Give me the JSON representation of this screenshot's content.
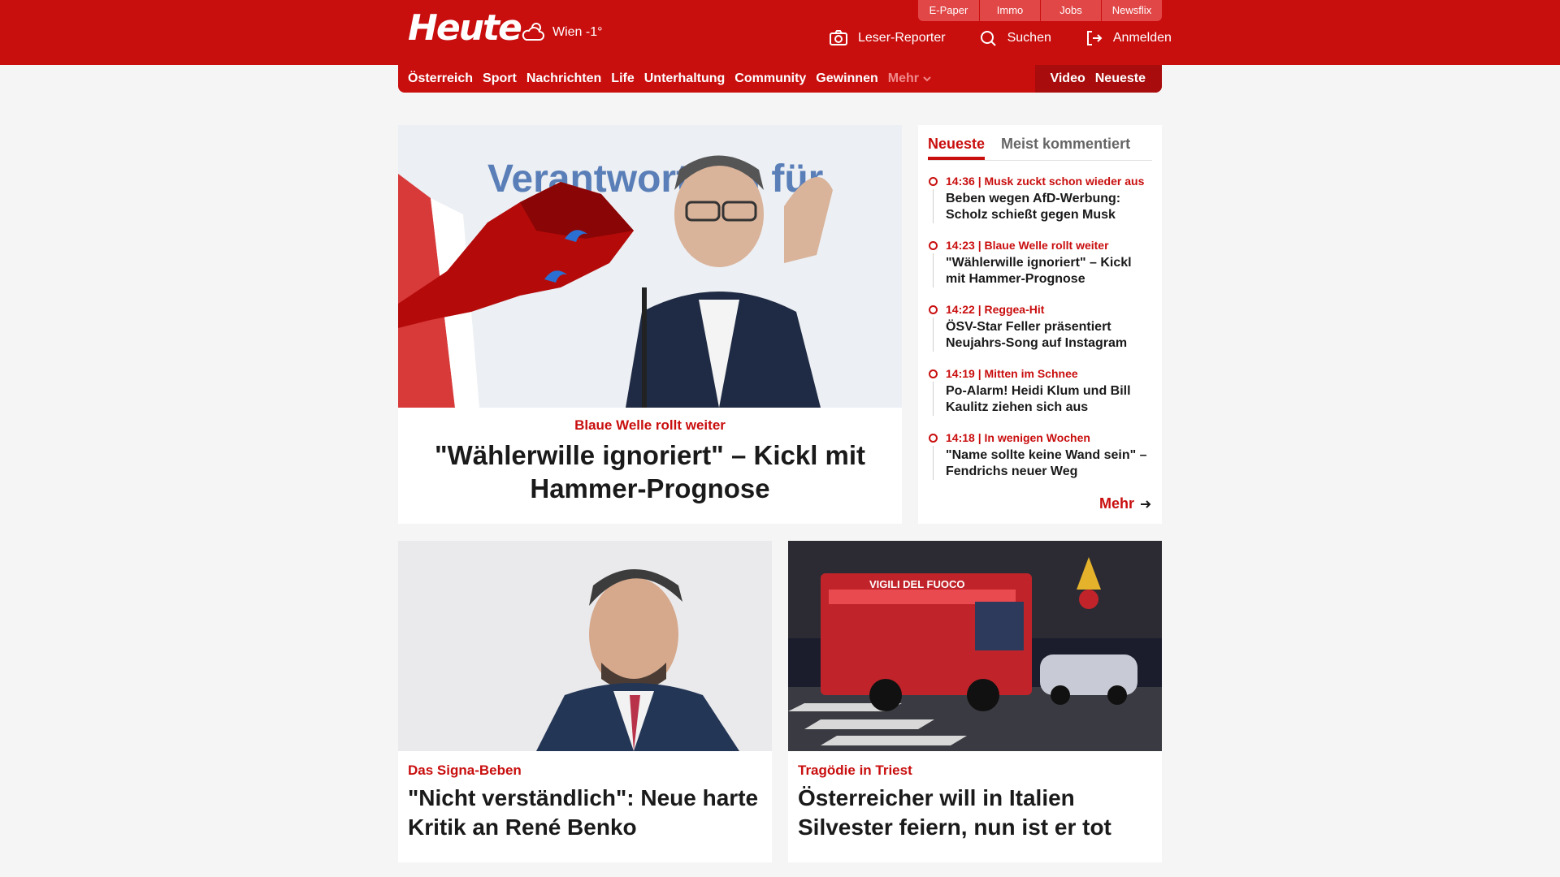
{
  "header": {
    "logo": "Heute",
    "weather": {
      "icon": "cloud-sun-icon",
      "label": "Wien -1°"
    },
    "top_links": [
      "E-Paper",
      "Immo",
      "Jobs",
      "Newsflix"
    ],
    "actions": [
      {
        "label": "Leser-Reporter",
        "icon": "camera-icon"
      },
      {
        "label": "Suchen",
        "icon": "search-icon"
      },
      {
        "label": "Anmelden",
        "icon": "login-icon"
      }
    ]
  },
  "nav": {
    "items": [
      "Österreich",
      "Sport",
      "Nachrichten",
      "Life",
      "Unterhaltung",
      "Community",
      "Gewinnen"
    ],
    "more": "Mehr",
    "right": [
      "Video",
      "Neueste"
    ]
  },
  "lead": {
    "kicker": "Blaue Welle rollt weiter",
    "title": "\"Wählerwille ignoriert\" – Kickl mit Hammer-Prognose",
    "image_text": "Verantwortung für"
  },
  "sidebar": {
    "tabs": [
      "Neueste",
      "Meist kommentiert"
    ],
    "active_tab": "Neueste",
    "items": [
      {
        "time": "14:36",
        "kicker": "Musk zuckt schon wieder aus",
        "title": "Beben wegen AfD-Werbung: Scholz schießt gegen Musk"
      },
      {
        "time": "14:23",
        "kicker": "Blaue Welle rollt weiter",
        "title": "\"Wählerwille ignoriert\" – Kickl mit Hammer-Prognose"
      },
      {
        "time": "14:22",
        "kicker": "Reggea-Hit",
        "title": "ÖSV-Star Feller präsentiert Neujahrs-Song auf Instagram"
      },
      {
        "time": "14:19",
        "kicker": "Mitten im Schnee",
        "title": "Po-Alarm! Heidi Klum und Bill Kaulitz ziehen sich aus"
      },
      {
        "time": "14:18",
        "kicker": "In wenigen Wochen",
        "title": "\"Name sollte keine Wand sein\" – Fendrichs neuer Weg"
      }
    ],
    "more": "Mehr"
  },
  "cards": [
    {
      "kicker": "Das Signa-Beben",
      "title": "\"Nicht verständlich\": Neue harte Kritik an René Benko"
    },
    {
      "kicker": "Tragödie in Triest",
      "title": "Österreicher will in Italien Silvester feiern, nun ist er tot",
      "image_text": "VIGILI DEL FUOCO"
    }
  ],
  "colors": {
    "brand": "#c90e0e",
    "brand_dark": "#a80c0c",
    "background": "#f5f5f5"
  }
}
